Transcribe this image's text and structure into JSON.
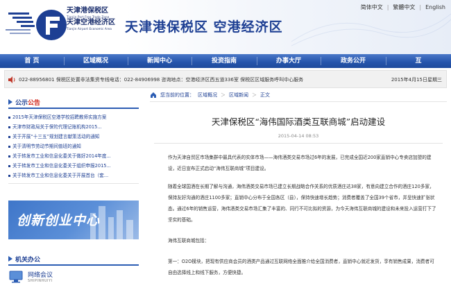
{
  "header": {
    "logo_cn_1": "天津港保税区",
    "logo_en_1": "Tianjin Port Free Trade Zone",
    "logo_cn_2": "天津空港经济区",
    "logo_en_2": "Tianjin Airport Economic Area",
    "site_title": "天津港保税区 空港经济区",
    "lang": {
      "simplified": "简体中文",
      "sep1": "|",
      "traditional": "繁體中文",
      "sep2": "|",
      "english": "English"
    }
  },
  "nav": {
    "items": [
      {
        "label": "首  页",
        "width": 92
      },
      {
        "label": "区域概况",
        "width": 92
      },
      {
        "label": "新闻中心",
        "width": 92
      },
      {
        "label": "投资指南",
        "width": 94
      },
      {
        "label": "办事大厅",
        "width": 92
      },
      {
        "label": "政务公开",
        "width": 94
      },
      {
        "label": "互",
        "width": 94
      }
    ]
  },
  "infobar": {
    "text": "022-88956801  保税区处置非法集资专线电话：022-84906998  咨询地点：空港经济区西五道336室  保税区区域服务呼叫中心服务",
    "date": "2015年4月15日星期三"
  },
  "notice": {
    "title": "公示",
    "title_accent": "公告",
    "items": [
      "2015年天津保税区空港学校招聘教师实施方案",
      "天津市财政局关于保险代理记账机构2015...",
      "关于开展“十三五”规划建言献策活动的通知",
      "关于清明节劳动节期间值班的通知",
      "关于转发市工业和信息化委关于做好2014年度...",
      "关于转发市工业和信息化委关于组织申报2015...",
      "关于转发市工业和信息化委关于开展首台（套..."
    ]
  },
  "banner": {
    "text": "创新创业中心"
  },
  "office": {
    "title": "机关办公",
    "label": "网络会议",
    "sub": "SHIPINHUIYI"
  },
  "main": {
    "breadcrumb_label": "您当前的位置：",
    "breadcrumb": [
      "区域概况",
      "区域新闻",
      "正文"
    ],
    "breadcrumb_sep": "＞",
    "title": "天津保税区“海伟国际酒类互联商城”启动建设",
    "date": "2015-04-14  08:53",
    "paragraphs": [
      "作为天津自贸区市场集群中最具代表的实体市场——海伟酒类交易市场过6年的发展，已完成全国近200家直销中心专卖店加盟的建设，近日宣布正式启动“海伟互联商城”项目建设。",
      "随着全球国酒在长期了解与沟通，海伟酒类交易市场已建立长期战略合作关系的优质酒庄达38家，有意向建立合作的酒庄120多家，保持友好沟通的酒庄1100多家；直销中心分布于全国各区（县），保持快速增长趋势；消费者覆盖了全国39个省市，并呈快速扩张状态。通过6年的销售运营，海伟酒类交易市场汇集了丰富的、同行不可比拟的资源，为今天海伟互联商城的建设和未来投入运营打下了坚实的基础。",
      "海伟互联商城包括：",
      "第一：O2O模块，把现有供应商会员的酒类产品通过互联网络全面推介给全国消费者，直销中心就近发货，享有销售成果，消费者可自由选择线上和线下服务，方便快捷。"
    ]
  },
  "colors": {
    "brand": "#1d3f93",
    "nav": "#2756ad",
    "accent": "#d0251a"
  }
}
